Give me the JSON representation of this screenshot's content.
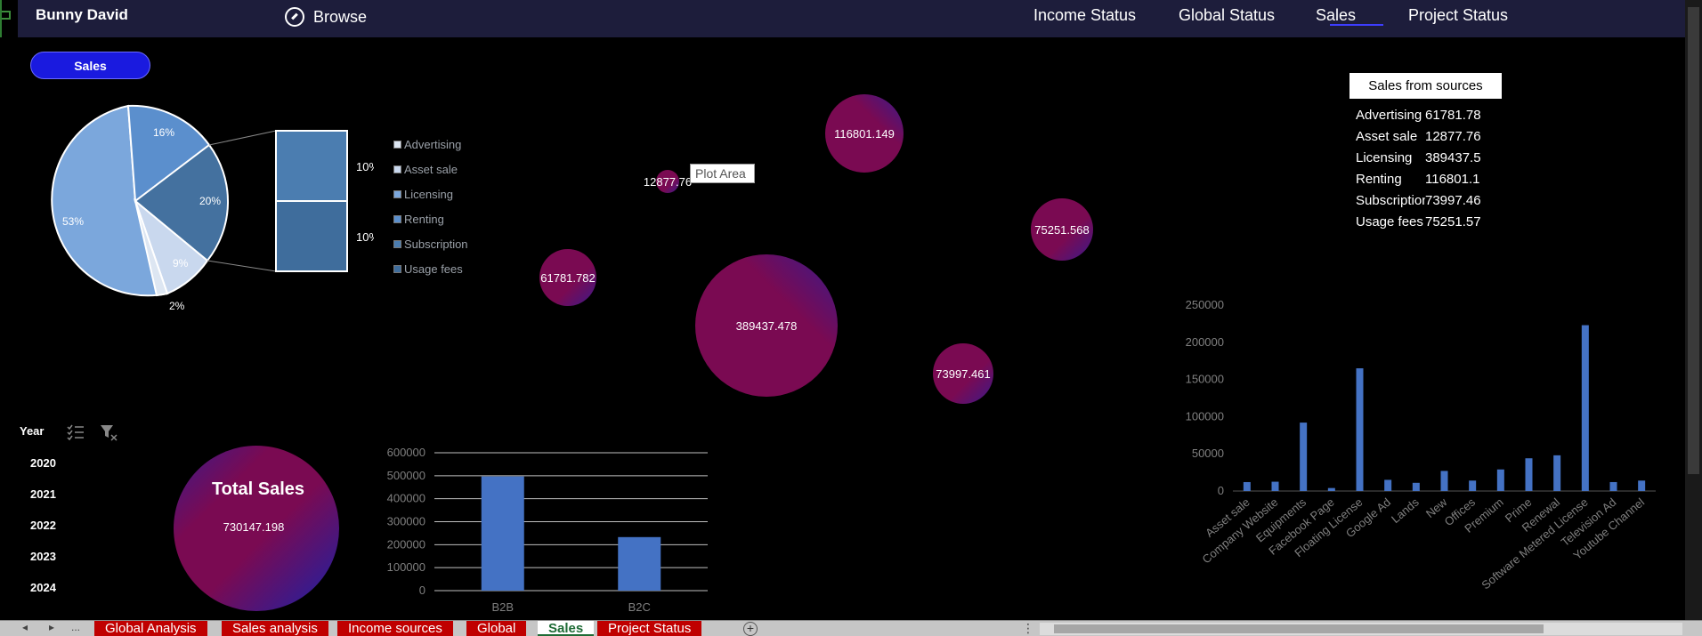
{
  "header": {
    "user_name": "Bunny David",
    "browse_label": "Browse",
    "nav": [
      "Income Status",
      "Global Status",
      "Sales",
      "Project Status"
    ],
    "active_nav": "Sales"
  },
  "sales_button": "Sales",
  "pie_chart": {
    "type": "pie",
    "slices": [
      {
        "label": "53%",
        "value": 53
      },
      {
        "label": "16%",
        "value": 16
      },
      {
        "label": "20%",
        "value": 20
      },
      {
        "label": "9%",
        "value": 9
      },
      {
        "label": "2%",
        "value": 2
      }
    ],
    "secondary_bars": [
      "10%",
      "10%"
    ],
    "legend": [
      "Advertising",
      "Asset sale",
      "Licensing",
      "Renting",
      "Subscription",
      "Usage fees"
    ]
  },
  "bubble_chart": {
    "type": "scatter",
    "tooltip": "Plot Area",
    "bubbles": [
      {
        "label": "61781.782",
        "value": 61781.782
      },
      {
        "label": "12877.76",
        "value": 12877.76
      },
      {
        "label": "389437.478",
        "value": 389437.478
      },
      {
        "label": "116801.149",
        "value": 116801.149
      },
      {
        "label": "73997.461",
        "value": 73997.461
      },
      {
        "label": "75251.568",
        "value": 75251.568
      }
    ]
  },
  "sources": {
    "title": "Sales from sources",
    "rows": [
      {
        "name": "Advertising",
        "value": "61781.78"
      },
      {
        "name": "Asset sale",
        "value": "12877.76"
      },
      {
        "name": "Licensing",
        "value": "389437.5"
      },
      {
        "name": "Renting",
        "value": "116801.1"
      },
      {
        "name": "Subscription",
        "value": "73997.46"
      },
      {
        "name": "Usage fees",
        "value": "75251.57"
      }
    ]
  },
  "chart_data": [
    {
      "type": "bar",
      "categories": [
        "Asset sale",
        "Company Website",
        "Equipments",
        "Facebook Page",
        "Floating License",
        "Google Ad",
        "Lands",
        "New",
        "Offices",
        "Premium",
        "Prime",
        "Renewal",
        "Software Metered License",
        "Television Ad",
        "Youtube Channel"
      ],
      "values": [
        12000,
        12500,
        92000,
        4000,
        165000,
        15000,
        11000,
        27000,
        14000,
        29000,
        44000,
        48000,
        223000,
        12000,
        14000
      ],
      "yticks": [
        "0",
        "50000",
        "100000",
        "150000",
        "200000",
        "250000"
      ],
      "ylim": [
        0,
        250000
      ]
    },
    {
      "type": "bar",
      "categories": [
        "B2B",
        "B2C"
      ],
      "values": [
        497000,
        233000
      ],
      "yticks": [
        "0",
        "100000",
        "200000",
        "300000",
        "400000",
        "500000",
        "600000"
      ],
      "ylim": [
        0,
        600000
      ]
    }
  ],
  "total_sales": {
    "title": "Total Sales",
    "value": "730147.198"
  },
  "slicer": {
    "title": "Year",
    "years": [
      "2020",
      "2021",
      "2022",
      "2023",
      "2024"
    ]
  },
  "sheet_tabs": {
    "nav": [
      "◂",
      "▸",
      "..."
    ],
    "tabs": [
      "Global Analysis",
      "Sales analysis",
      "Income sources",
      "Global",
      "Sales",
      "Project Status"
    ],
    "active": "Sales",
    "add": "+",
    "more": "⋮"
  },
  "colors": {
    "bar": "#4472c4",
    "bubble": "#7a0a52",
    "bubble_accent": "#3a1a8a",
    "pie": "#7ba7dc",
    "header": "#1d1d3b",
    "tab": "#c00000"
  }
}
